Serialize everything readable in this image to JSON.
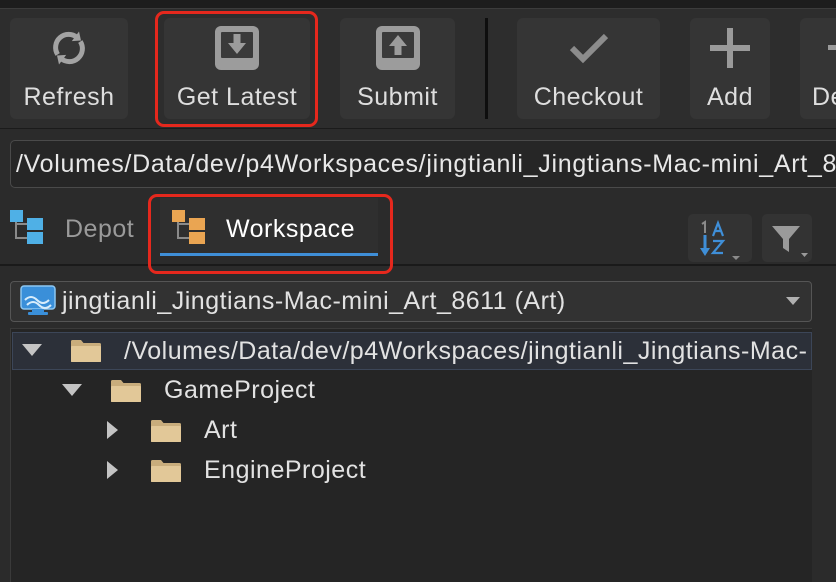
{
  "toolbar": {
    "buttons": [
      {
        "label": "Refresh",
        "icon": "refresh-icon"
      },
      {
        "label": "Get Latest",
        "icon": "get-latest-icon",
        "highlighted": true
      },
      {
        "label": "Submit",
        "icon": "submit-icon"
      },
      {
        "label": "Checkout",
        "icon": "checkmark-icon"
      },
      {
        "label": "Add",
        "icon": "plus-icon"
      },
      {
        "label": "De",
        "icon": "minus-icon"
      }
    ]
  },
  "path_field": {
    "value": "/Volumes/Data/dev/p4Workspaces/jingtianli_Jingtians-Mac-mini_Art_86"
  },
  "tabs": [
    {
      "label": "Depot",
      "icon": "depot-tree-icon",
      "active": false
    },
    {
      "label": "Workspace",
      "icon": "workspace-tree-icon",
      "active": true,
      "highlighted": true
    }
  ],
  "tab_tools": {
    "sort_icon": "sort-az-icon",
    "filter_icon": "filter-icon"
  },
  "workspace_selector": {
    "value": "jingtianli_Jingtians-Mac-mini_Art_8611 (Art)",
    "icon": "workspace-monitor-icon"
  },
  "tree": {
    "items": [
      {
        "label": "/Volumes/Data/dev/p4Workspaces/jingtianli_Jingtians-Mac-",
        "expanded": true,
        "selected": true,
        "icon": "folder-icon"
      },
      {
        "label": "GameProject",
        "expanded": true,
        "selected": false,
        "icon": "folder-icon"
      },
      {
        "label": "Art",
        "expanded": false,
        "selected": false,
        "icon": "folder-icon"
      },
      {
        "label": "EngineProject",
        "expanded": false,
        "selected": false,
        "icon": "folder-icon"
      }
    ]
  },
  "colors": {
    "background": "#2b2b2b",
    "accent": "#3f8fd8",
    "annotation": "#e5281d",
    "depot_icon": "#4fb0e6",
    "workspace_icon": "#eaa552",
    "folder": "#e2c898"
  }
}
